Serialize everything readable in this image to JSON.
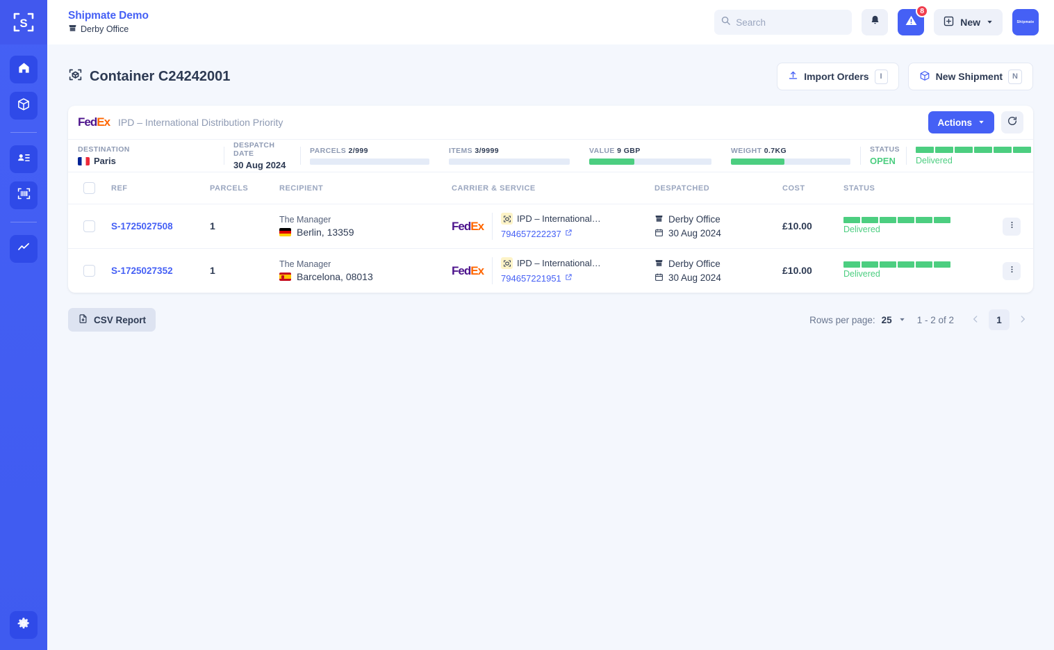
{
  "sidebar": {
    "logo_icon": "shipmate-scan-logo",
    "items": [
      {
        "icon": "home-icon",
        "name": "sidebar-item-home"
      },
      {
        "icon": "package-icon",
        "name": "sidebar-item-shipments"
      },
      {
        "icon": "contact-card-icon",
        "name": "sidebar-item-contacts"
      },
      {
        "icon": "barcode-icon",
        "name": "sidebar-item-scan"
      },
      {
        "icon": "analytics-icon",
        "name": "sidebar-item-reports"
      }
    ],
    "settings_icon": "gear-icon"
  },
  "topbar": {
    "org_name": "Shipmate Demo",
    "office": "Derby Office",
    "office_icon": "store-icon",
    "search": {
      "placeholder": "Search",
      "value": "",
      "shortcut": "/",
      "icon": "search-icon"
    },
    "notifications_icon": "bell-icon",
    "alerts_icon": "warning-triangle-icon",
    "alerts_count": "8",
    "new_label": "New",
    "new_icon": "plus-square-icon",
    "avatar_label": "Shipmate"
  },
  "page": {
    "title": "Container C24242001",
    "title_icon": "container-scan-icon",
    "import_orders_label": "Import Orders",
    "import_orders_icon": "upload-icon",
    "import_orders_shortcut": "I",
    "new_shipment_label": "New Shipment",
    "new_shipment_icon": "package-icon",
    "new_shipment_shortcut": "N"
  },
  "card": {
    "carrier_logo": {
      "fed": "Fed",
      "ex": "Ex"
    },
    "service": "IPD – International Distribution Priority",
    "actions_label": "Actions",
    "actions_caret_icon": "chevron-down-icon",
    "refresh_icon": "refresh-icon",
    "stats": [
      {
        "label": "Destination",
        "value": "Paris",
        "flag": "fr",
        "type": "flag"
      },
      {
        "label": "Despatch Date",
        "value": "30 Aug 2024",
        "type": "text"
      },
      {
        "label": "Parcels",
        "value": "2/999",
        "type": "bar",
        "percent": 0
      },
      {
        "label": "Items",
        "value": "3/9999",
        "type": "bar",
        "percent": 0
      },
      {
        "label": "Value",
        "value": "9 GBP",
        "type": "bar",
        "percent": 37
      },
      {
        "label": "Weight",
        "value": "0.7KG",
        "type": "bar",
        "percent": 45
      }
    ],
    "status": {
      "label": "Status",
      "value": "OPEN",
      "progress_text": "Delivered",
      "segments": 6,
      "segments_filled": 6
    }
  },
  "table": {
    "columns": [
      "Ref",
      "Parcels",
      "Recipient",
      "Carrier & Service",
      "Despatched",
      "Cost",
      "Status"
    ],
    "select_all_checked": false,
    "rows": [
      {
        "selected": false,
        "ref": "S-1725027508",
        "parcels": "1",
        "recipient_name": "The Manager",
        "recipient_city": "Berlin, 13359",
        "recipient_flag": "de",
        "carrier_logo": {
          "fed": "Fed",
          "ex": "Ex"
        },
        "service": "IPD – International…",
        "service_icon": "container-box-icon",
        "tracking": "794657222237",
        "tracking_icon": "external-link-icon",
        "despatch_office": "Derby Office",
        "despatch_office_icon": "store-icon",
        "despatch_date": "30 Aug 2024",
        "despatch_date_icon": "calendar-icon",
        "cost": "£10.00",
        "status_text": "Delivered",
        "segments": 6,
        "segments_filled": 6,
        "menu_icon": "kebab-menu-icon"
      },
      {
        "selected": false,
        "ref": "S-1725027352",
        "parcels": "1",
        "recipient_name": "The Manager",
        "recipient_city": "Barcelona, 08013",
        "recipient_flag": "es",
        "carrier_logo": {
          "fed": "Fed",
          "ex": "Ex"
        },
        "service": "IPD – International…",
        "service_icon": "container-box-icon",
        "tracking": "794657221951",
        "tracking_icon": "external-link-icon",
        "despatch_office": "Derby Office",
        "despatch_office_icon": "store-icon",
        "despatch_date": "30 Aug 2024",
        "despatch_date_icon": "calendar-icon",
        "cost": "£10.00",
        "status_text": "Delivered",
        "segments": 6,
        "segments_filled": 6,
        "menu_icon": "kebab-menu-icon"
      }
    ]
  },
  "footer": {
    "csv_label": "CSV Report",
    "csv_icon": "file-download-icon",
    "rows_per_page_label": "Rows per page:",
    "rows_per_page_value": "25",
    "range": "1 - 2 of 2",
    "prev_icon": "chevron-left-icon",
    "next_icon": "chevron-right-icon",
    "current_page": "1"
  },
  "colors": {
    "brand": "#4560f5",
    "success": "#4cce80",
    "danger": "#f03d4e",
    "fedex_purple": "#4d148c",
    "fedex_orange": "#ff6600",
    "text": "#2d3a53",
    "muted": "#8e9ab3",
    "page_bg": "#f4f7fd"
  }
}
